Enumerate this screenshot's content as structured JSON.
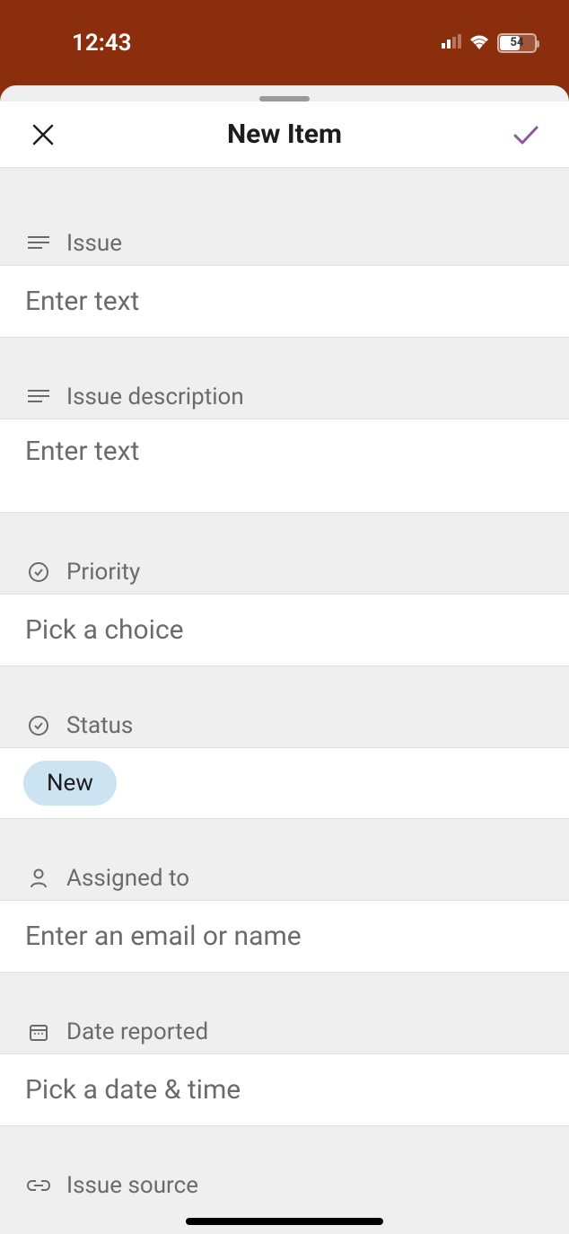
{
  "statusBar": {
    "time": "12:43",
    "battery": "54"
  },
  "nav": {
    "title": "New Item"
  },
  "fields": {
    "issue": {
      "label": "Issue",
      "placeholder": "Enter text"
    },
    "issueDescription": {
      "label": "Issue description",
      "placeholder": "Enter text"
    },
    "priority": {
      "label": "Priority",
      "placeholder": "Pick a choice"
    },
    "status": {
      "label": "Status",
      "value": "New"
    },
    "assignedTo": {
      "label": "Assigned to",
      "placeholder": "Enter an email or name"
    },
    "dateReported": {
      "label": "Date reported",
      "placeholder": "Pick a date & time"
    },
    "issueSource": {
      "label": "Issue source"
    }
  }
}
